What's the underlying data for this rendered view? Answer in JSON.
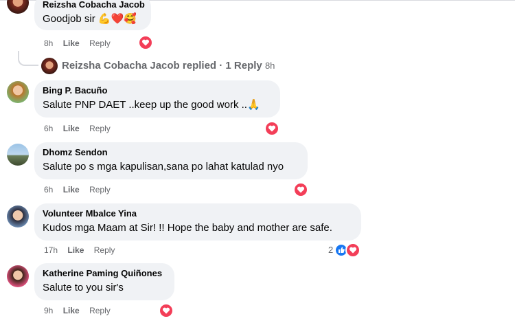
{
  "comments": [
    {
      "author": "Reizsha Cobacha Jacob",
      "text": "Goodjob sir 💪❤️🥰",
      "time": "8h",
      "like": "Like",
      "reply": "Reply"
    },
    {
      "author": "Bing P. Bacuño",
      "text": "Salute PNP DAET ..keep up the good work ..🙏",
      "time": "6h",
      "like": "Like",
      "reply": "Reply"
    },
    {
      "author": "Dhomz Sendon",
      "text": "Salute po s mga kapulisan,sana po lahat katulad nyo",
      "time": "6h",
      "like": "Like",
      "reply": "Reply"
    },
    {
      "author": "Volunteer Mbalce Yina",
      "text": "Kudos mga Maam at Sir! !! Hope the baby and mother are safe.",
      "time": "17h",
      "like": "Like",
      "reply": "Reply",
      "reaction_count": "2"
    },
    {
      "author": "Katherine Paming Quiñones",
      "text": "Salute to you sir's",
      "time": "9h",
      "like": "Like",
      "reply": "Reply"
    }
  ],
  "reply_thread": {
    "label": "Reizsha Cobacha Jacob replied · 1 Reply",
    "time": "8h"
  },
  "colors": {
    "bubble": "#f0f2f5",
    "love": "#f33e58",
    "like": "#1877f2",
    "meta": "#65676b"
  }
}
